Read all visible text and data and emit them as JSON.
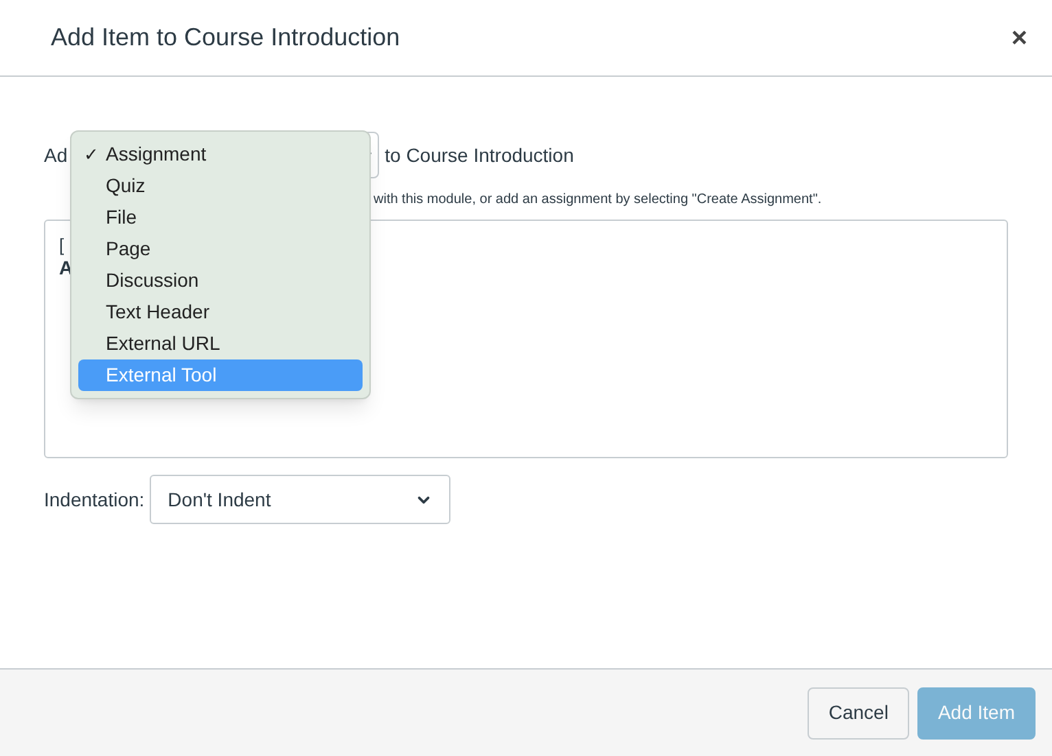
{
  "dialog": {
    "title": "Add Item to Course Introduction",
    "close": "×"
  },
  "add_row": {
    "prefix": "Ad",
    "suffix": "to Course Introduction"
  },
  "hint": "with this module, or add an assignment by selecting \"Create Assignment\".",
  "list_box": {
    "lines": [
      "[",
      "A"
    ]
  },
  "type_menu": {
    "items": [
      {
        "label": "Assignment",
        "checked": true,
        "highlighted": false
      },
      {
        "label": "Quiz",
        "checked": false,
        "highlighted": false
      },
      {
        "label": "File",
        "checked": false,
        "highlighted": false
      },
      {
        "label": "Page",
        "checked": false,
        "highlighted": false
      },
      {
        "label": "Discussion",
        "checked": false,
        "highlighted": false
      },
      {
        "label": "Text Header",
        "checked": false,
        "highlighted": false
      },
      {
        "label": "External URL",
        "checked": false,
        "highlighted": false
      },
      {
        "label": "External Tool",
        "checked": false,
        "highlighted": true
      }
    ],
    "check": "✓"
  },
  "indentation": {
    "label": "Indentation:",
    "value": "Don't Indent"
  },
  "buttons": [
    {
      "label": "Cancel",
      "kind": "secondary",
      "disabled": false
    },
    {
      "label": "Add Item",
      "kind": "primary",
      "disabled": true
    }
  ]
}
